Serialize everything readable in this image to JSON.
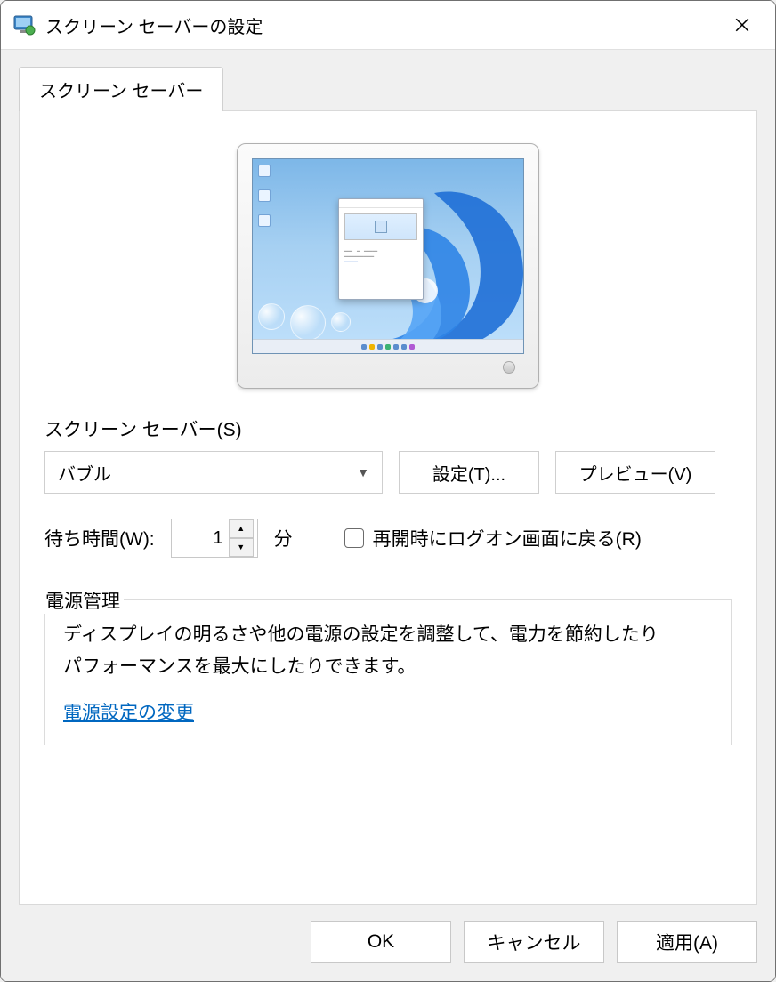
{
  "window": {
    "title": "スクリーン セーバーの設定"
  },
  "tab": {
    "label": "スクリーン セーバー"
  },
  "section": {
    "screensaver_label": "スクリーン セーバー(S)",
    "select_value": "バブル",
    "settings_btn": "設定(T)...",
    "preview_btn": "プレビュー(V)",
    "wait_label": "待ち時間(W):",
    "wait_value": "1",
    "wait_unit": "分",
    "resume_label": "再開時にログオン画面に戻る(R)"
  },
  "power": {
    "legend": "電源管理",
    "text_line1": "ディスプレイの明るさや他の電源の設定を調整して、電力を節約したり",
    "text_line2": "パフォーマンスを最大にしたりできます。",
    "link": "電源設定の変更"
  },
  "buttons": {
    "ok": "OK",
    "cancel": "キャンセル",
    "apply": "適用(A)"
  }
}
